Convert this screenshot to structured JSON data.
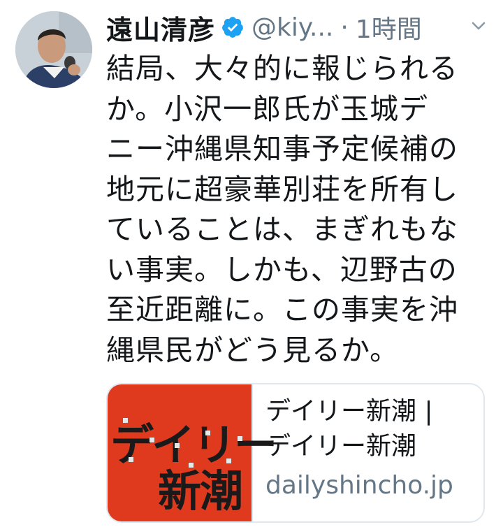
{
  "tweet": {
    "author_name": "遠山清彦",
    "handle": "@kiy...",
    "separator": "·",
    "time": "1時間",
    "text": "結局、大々的に報じられるか。小沢一郎氏が玉城デニー沖縄県知事予定候補の地元に超豪華別荘を所有していることは、まぎれもない事実。しかも、辺野古の至近距離に。この事実を沖縄県民がどう見るか。",
    "text_lines": "結局、大々的に報じられる\nか。小沢一郎氏が玉城デ\nニー沖縄県知事予定候補の\n地元に超豪華別荘を所有し\nていることは、まぎれもな\nい事実。しかも、辺野古の\n至近距離に。この事実を沖\n縄県民がどう見るか。"
  },
  "card": {
    "thumb_line1": "デイリー",
    "thumb_line2": "新潮",
    "title": "デイリー新潮 |\nデイリー新潮",
    "domain": "dailyshincho.jp"
  },
  "icons": {
    "avatar": "profile-photo",
    "verified": "verified-badge-icon",
    "caret": "chevron-down-icon"
  },
  "colors": {
    "text": "#14171a",
    "secondary": "#657786",
    "verified_blue": "#1da1f2",
    "card_border": "#e1e8ed",
    "thumb_red": "#e03a1e"
  }
}
